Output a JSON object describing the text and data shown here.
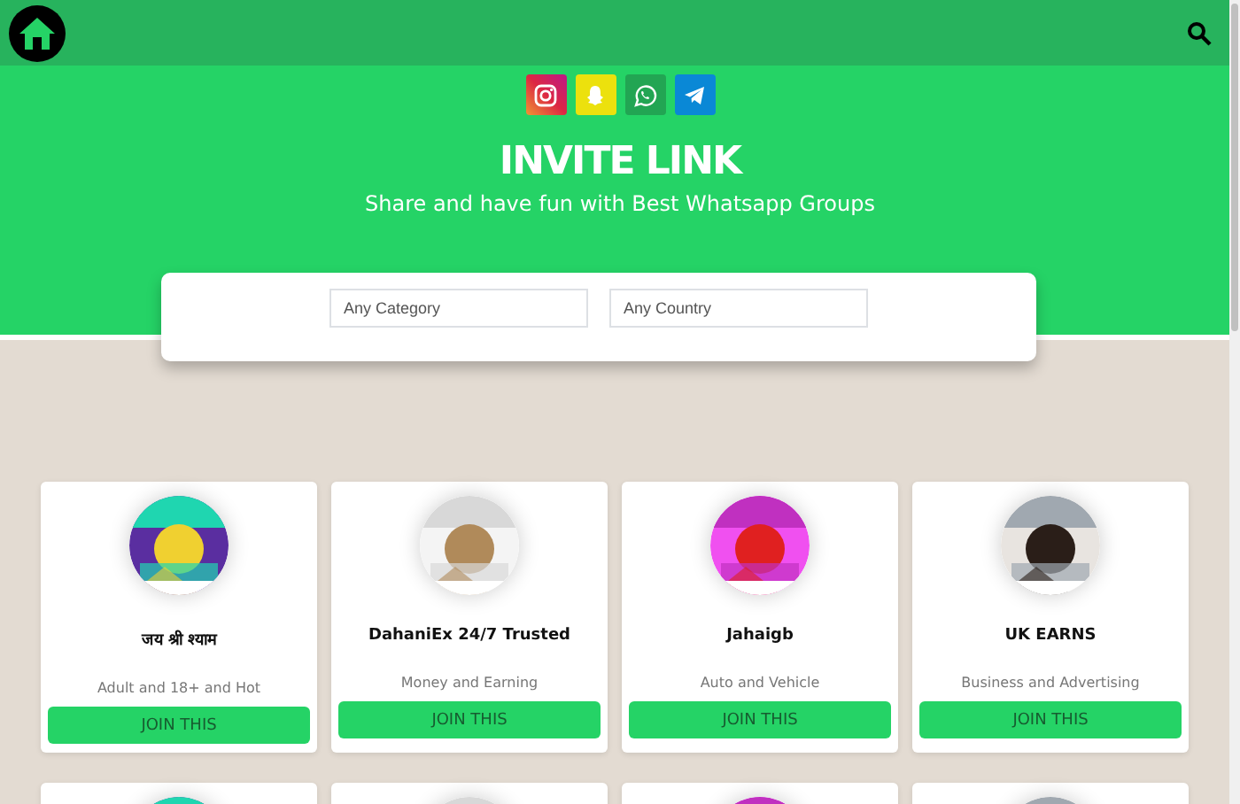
{
  "hero": {
    "title": "INVITE LINK",
    "subtitle": "Share and have fun with Best Whatsapp Groups"
  },
  "filters": [
    {
      "placeholder": "Any Category"
    },
    {
      "placeholder": "Any Country"
    }
  ],
  "groups": [
    {
      "kind": "card",
      "name": "जय श्री श्याम",
      "category": "Adult and 18+ and Hot",
      "button": "JOIN THIS"
    },
    {
      "kind": "card",
      "name": "DahaniEx 24/7 Trusted",
      "category": "Money and Earning",
      "button": "JOIN THIS"
    },
    {
      "kind": "card",
      "name": "Jahaigb",
      "category": "Auto and Vehicle",
      "button": "JOIN THIS"
    },
    {
      "kind": "card",
      "name": "UK EARNS",
      "category": "Business and Advertising",
      "button": "JOIN THIS"
    },
    {
      "kind": "picture"
    },
    {
      "kind": "picture"
    },
    {
      "kind": "picture"
    },
    {
      "kind": "picture"
    }
  ]
}
